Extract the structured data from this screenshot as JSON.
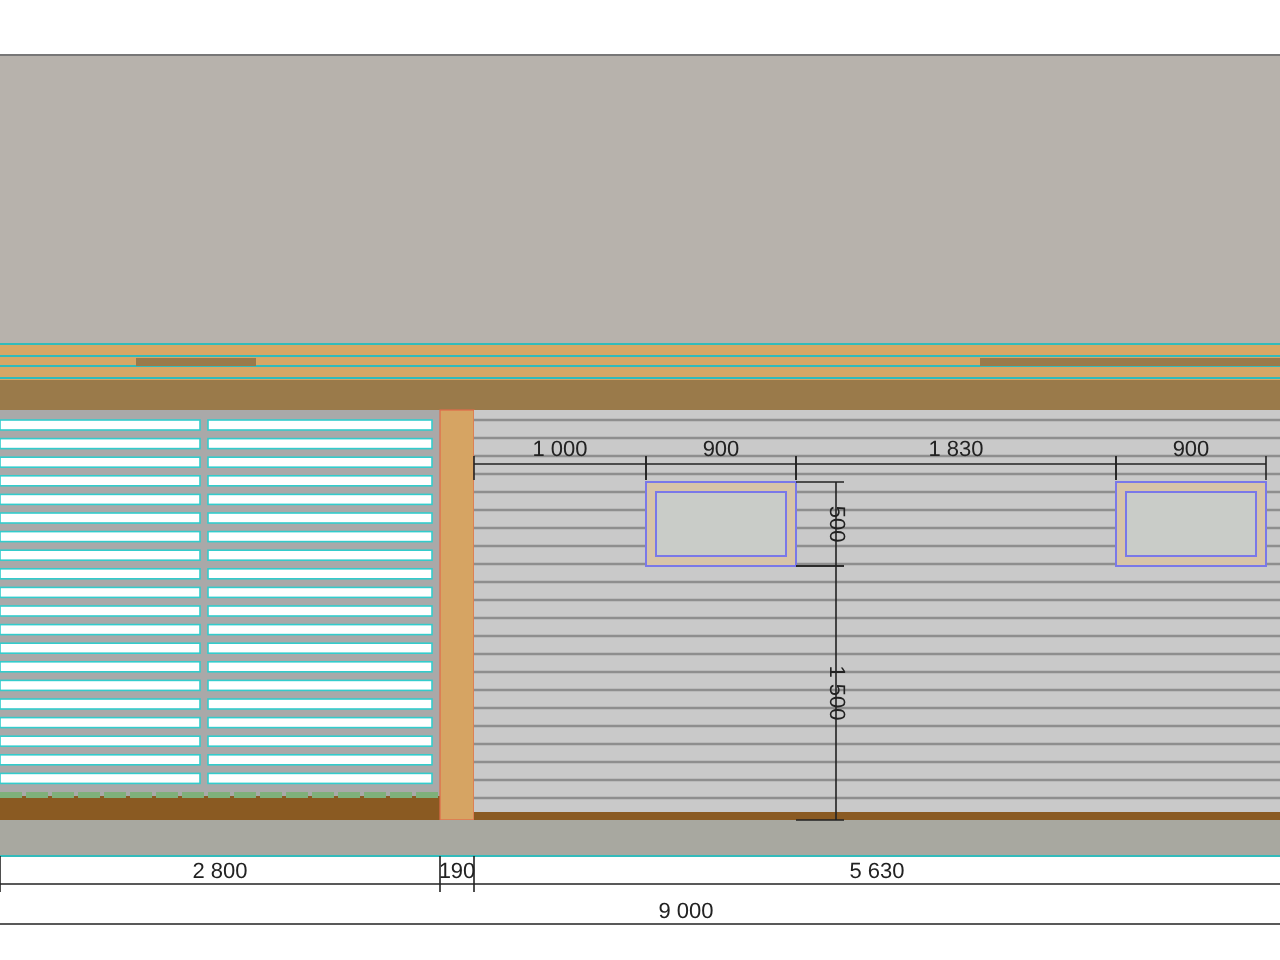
{
  "elevation": {
    "top_dimensions": [
      "1 000",
      "900",
      "1 830",
      "900"
    ],
    "vertical_dimensions": [
      "500",
      "1 500"
    ],
    "bottom_dimensions": [
      "2 800",
      "190",
      "5 630"
    ],
    "overall_dimension": "9 000"
  }
}
